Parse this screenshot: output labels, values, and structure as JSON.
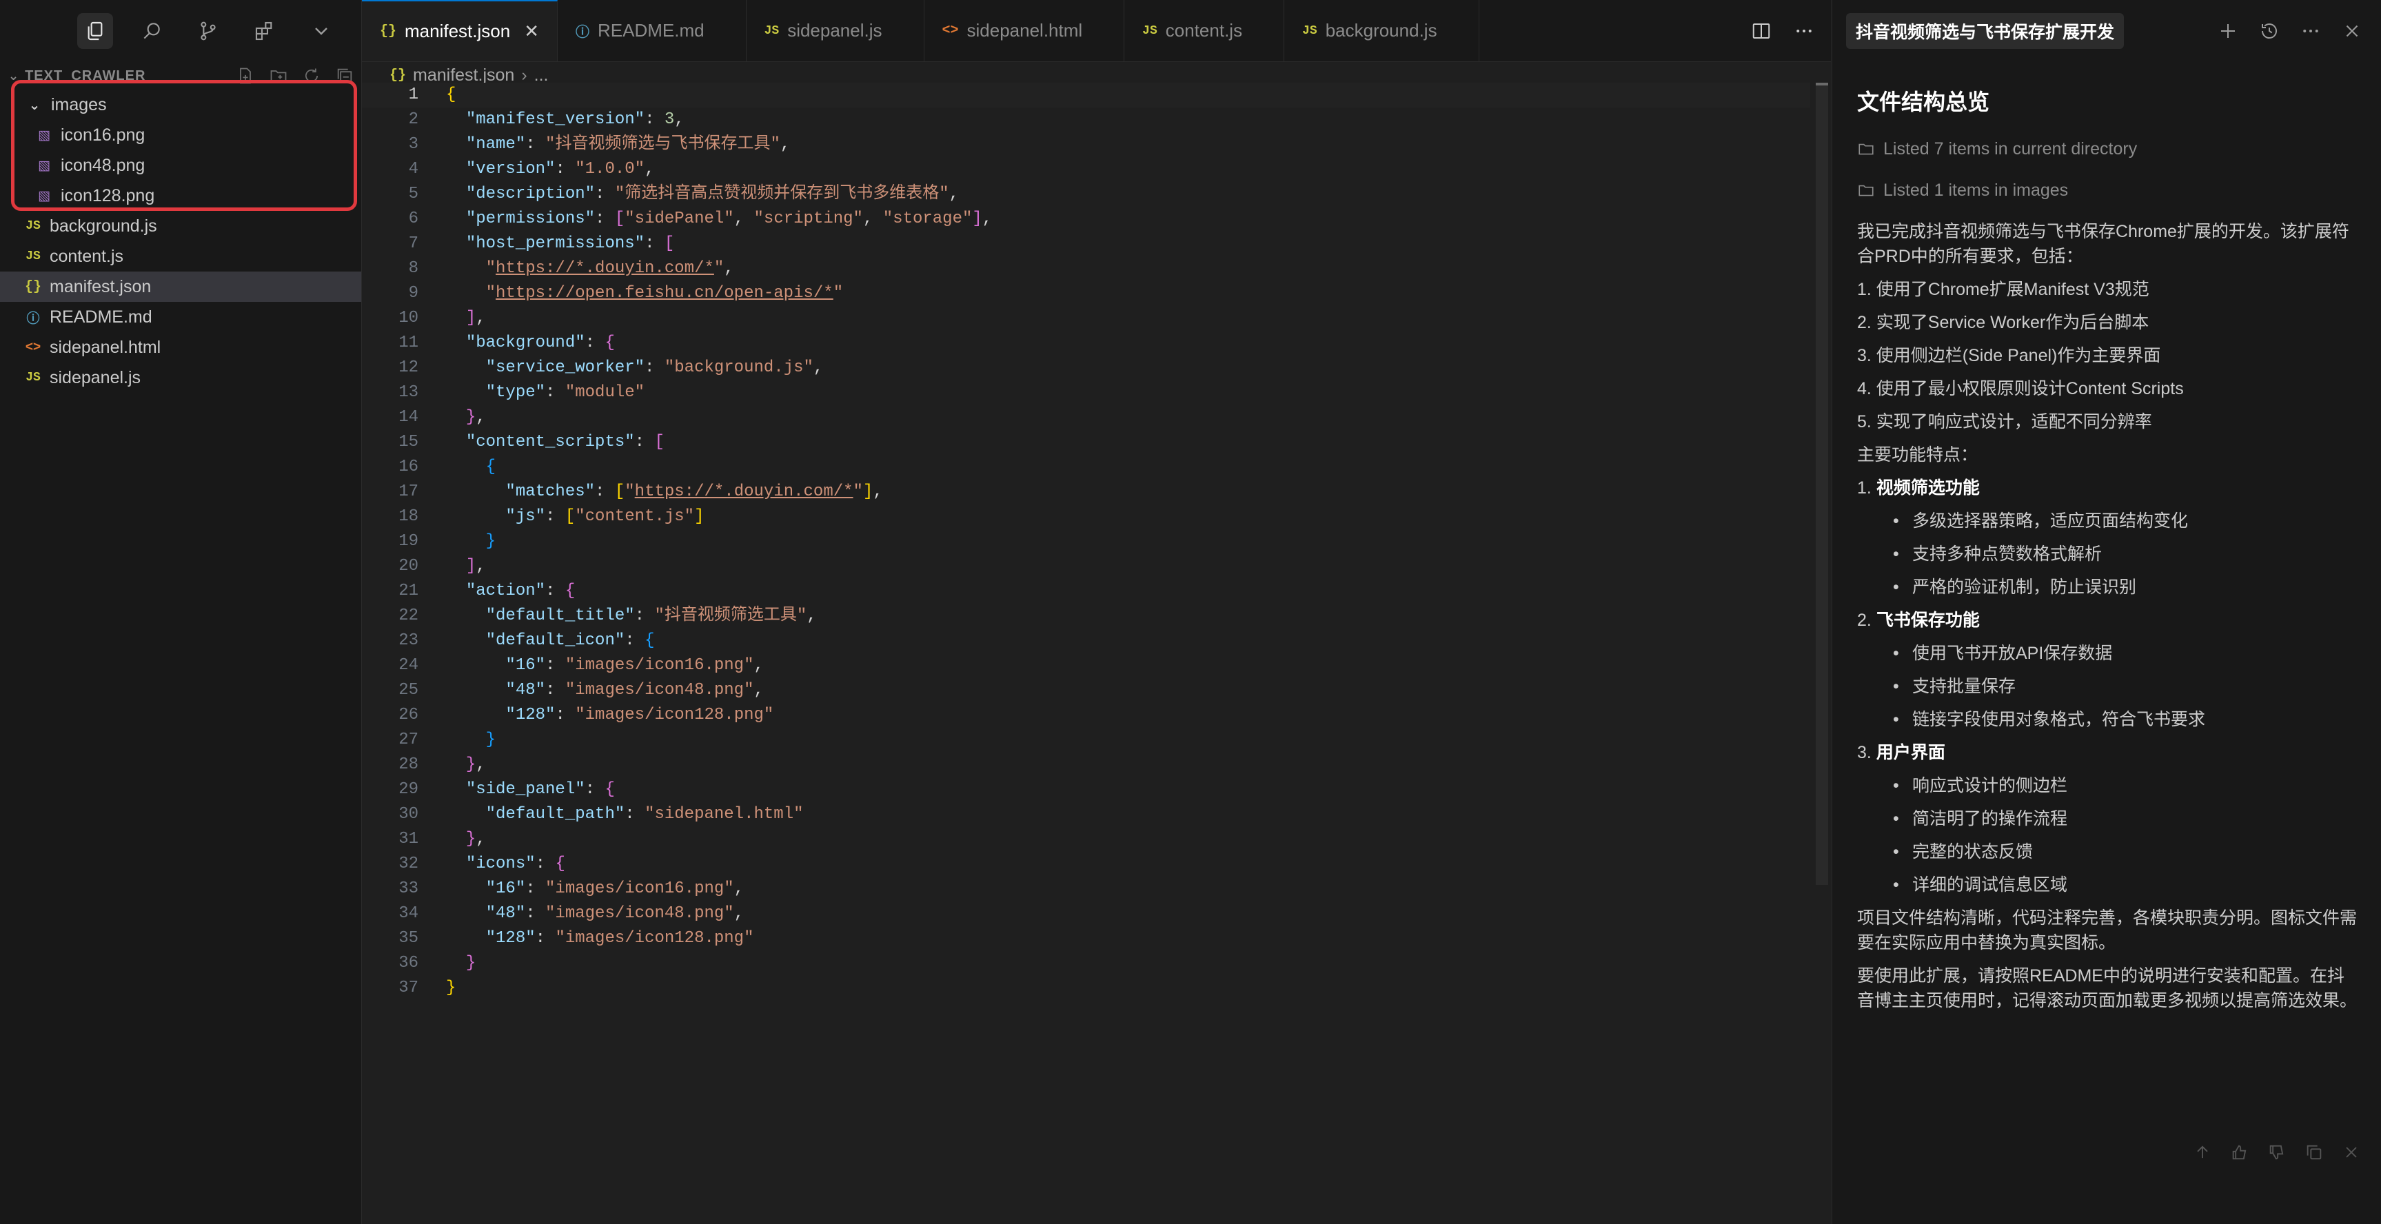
{
  "explorer": {
    "title": "TEXT_CRAWLER",
    "folder": "images",
    "images": [
      "icon16.png",
      "icon48.png",
      "icon128.png"
    ],
    "files": [
      {
        "name": "background.js",
        "type": "js"
      },
      {
        "name": "content.js",
        "type": "js"
      },
      {
        "name": "manifest.json",
        "type": "json",
        "selected": true
      },
      {
        "name": "README.md",
        "type": "md"
      },
      {
        "name": "sidepanel.html",
        "type": "html"
      },
      {
        "name": "sidepanel.js",
        "type": "js"
      }
    ]
  },
  "tabs": [
    {
      "label": "manifest.json",
      "icon": "{ }",
      "active": true
    },
    {
      "label": "README.md",
      "icon": "ⓘ"
    },
    {
      "label": "sidepanel.js",
      "icon": "JS"
    },
    {
      "label": "sidepanel.html",
      "icon": "<>"
    },
    {
      "label": "content.js",
      "icon": "JS"
    },
    {
      "label": "background.js",
      "icon": "JS"
    }
  ],
  "breadcrumb": {
    "file": "manifest.json",
    "rest": "..."
  },
  "code_lines": [
    "{",
    "  \"manifest_version\": 3,",
    "  \"name\": \"抖音视频筛选与飞书保存工具\",",
    "  \"version\": \"1.0.0\",",
    "  \"description\": \"筛选抖音高点赞视频并保存到飞书多维表格\",",
    "  \"permissions\": [\"sidePanel\", \"scripting\", \"storage\"],",
    "  \"host_permissions\": [",
    "    \"https://*.douyin.com/*\",",
    "    \"https://open.feishu.cn/open-apis/*\"",
    "  ],",
    "  \"background\": {",
    "    \"service_worker\": \"background.js\",",
    "    \"type\": \"module\"",
    "  },",
    "  \"content_scripts\": [",
    "    {",
    "      \"matches\": [\"https://*.douyin.com/*\"],",
    "      \"js\": [\"content.js\"]",
    "    }",
    "  ],",
    "  \"action\": {",
    "    \"default_title\": \"抖音视频筛选工具\",",
    "    \"default_icon\": {",
    "      \"16\": \"images/icon16.png\",",
    "      \"48\": \"images/icon48.png\",",
    "      \"128\": \"images/icon128.png\"",
    "    }",
    "  },",
    "  \"side_panel\": {",
    "    \"default_path\": \"sidepanel.html\"",
    "  },",
    "  \"icons\": {",
    "    \"16\": \"images/icon16.png\",",
    "    \"48\": \"images/icon48.png\",",
    "    \"128\": \"images/icon128.png\"",
    "  }",
    "}"
  ],
  "chat": {
    "title": "抖音视频筛选与飞书保存扩展开发",
    "heading": "文件结构总览",
    "listed": [
      "Listed 7 items in current directory",
      "Listed 1 items in images"
    ],
    "intro": "我已完成抖音视频筛选与飞书保存Chrome扩展的开发。该扩展符合PRD中的所有要求，包括：",
    "requirements": [
      "1. 使用了Chrome扩展Manifest V3规范",
      "2. 实现了Service Worker作为后台脚本",
      "3. 使用侧边栏(Side Panel)作为主要界面",
      "4. 使用了最小权限原则设计Content Scripts",
      "5. 实现了响应式设计，适配不同分辨率"
    ],
    "features_label": "主要功能特点：",
    "features": [
      {
        "num": "1.",
        "title": "视频筛选功能",
        "items": [
          "多级选择器策略，适应页面结构变化",
          "支持多种点赞数格式解析",
          "严格的验证机制，防止误识别"
        ]
      },
      {
        "num": "2.",
        "title": "飞书保存功能",
        "items": [
          "使用飞书开放API保存数据",
          "支持批量保存",
          "链接字段使用对象格式，符合飞书要求"
        ]
      },
      {
        "num": "3.",
        "title": "用户界面",
        "items": [
          "响应式设计的侧边栏",
          "简洁明了的操作流程",
          "完整的状态反馈",
          "详细的调试信息区域"
        ]
      }
    ],
    "conclusion1": "项目文件结构清晰，代码注释完善，各模块职责分明。图标文件需要在实际应用中替换为真实图标。",
    "conclusion2": "要使用此扩展，请按照README中的说明进行安装和配置。在抖音博主主页使用时，记得滚动页面加载更多视频以提高筛选效果。"
  }
}
